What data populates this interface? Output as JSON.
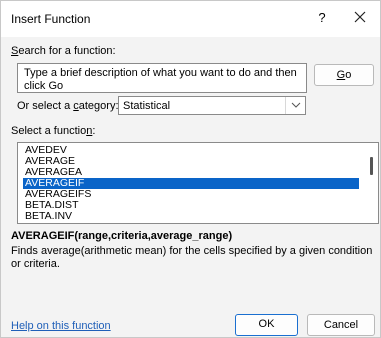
{
  "dialog": {
    "title": "Insert Function",
    "help_symbol": "?"
  },
  "search": {
    "label_key": "S",
    "label_rest": "earch for a function:",
    "value": "Type a brief description of what you want to do and then click Go",
    "go_label_key": "G",
    "go_label_rest": "o"
  },
  "category": {
    "label_pre": "Or select a ",
    "label_key": "c",
    "label_post": "ategory:",
    "selected": "Statistical"
  },
  "function_list": {
    "label_pre": "Select a functio",
    "label_key": "n",
    "label_post": ":",
    "items": [
      "AVEDEV",
      "AVERAGE",
      "AVERAGEA",
      "AVERAGEIF",
      "AVERAGEIFS",
      "BETA.DIST",
      "BETA.INV"
    ],
    "selected_index": 3
  },
  "selected_function": {
    "syntax": "AVERAGEIF(range,criteria,average_range)",
    "description": "Finds average(arithmetic mean) for the cells specified by a given condition or criteria."
  },
  "footer": {
    "help_link": "Help on this function",
    "ok_label": "OK",
    "cancel_label": "Cancel"
  },
  "colors": {
    "selection": "#0a64c8",
    "link": "#1f5fb8",
    "default_button_border": "#1a6fd0"
  }
}
